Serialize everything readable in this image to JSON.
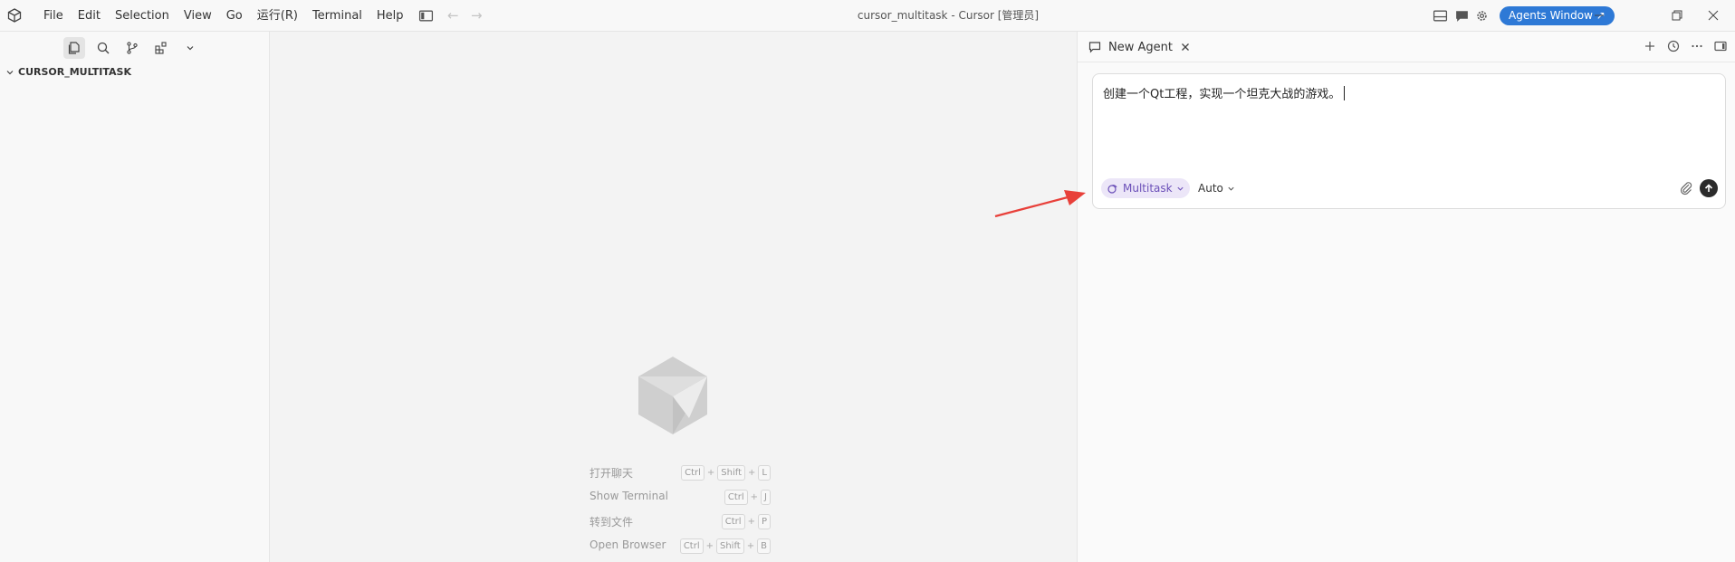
{
  "menu": [
    "File",
    "Edit",
    "Selection",
    "View",
    "Go",
    "运行(R)",
    "Terminal",
    "Help"
  ],
  "window_title": "cursor_multitask - Cursor [管理员]",
  "titlebar": {
    "agents_window_label": "Agents Window",
    "agents_window_icon": "arrow-up-right-icon"
  },
  "sidebar": {
    "explorer_title": "CURSOR_MULTITASK"
  },
  "editor": {
    "shortcuts": [
      {
        "label": "打开聊天",
        "keys": [
          "Ctrl",
          "Shift",
          "L"
        ]
      },
      {
        "label": "Show Terminal",
        "keys": [
          "Ctrl",
          "J"
        ]
      },
      {
        "label": "转到文件",
        "keys": [
          "Ctrl",
          "P"
        ]
      },
      {
        "label": "Open Browser",
        "keys": [
          "Ctrl",
          "Shift",
          "B"
        ]
      }
    ]
  },
  "agent": {
    "tab_label": "New Agent",
    "prompt_text": "创建一个Qt工程，实现一个坦克大战的游戏。",
    "mode_label": "Multitask",
    "model_label": "Auto"
  },
  "colors": {
    "accent": "#2e79d6",
    "multitask_bg": "#ece6f8",
    "multitask_fg": "#6b4fb8",
    "annotation_arrow": "#e8403a"
  }
}
